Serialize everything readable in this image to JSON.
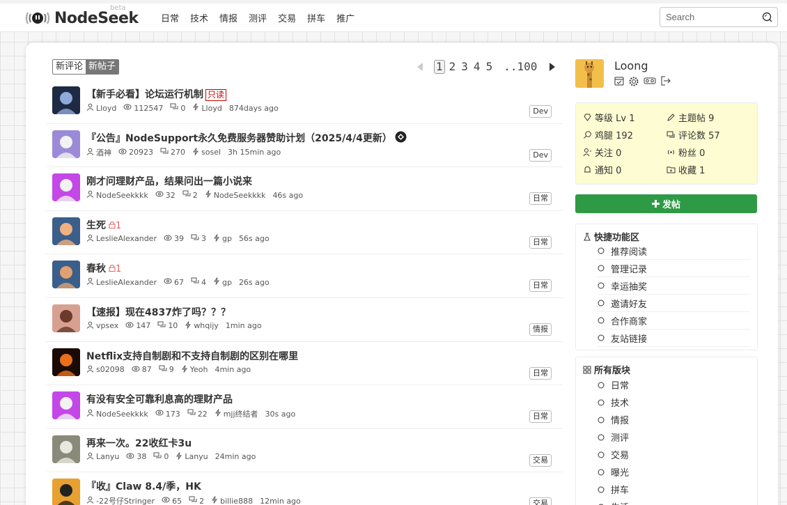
{
  "header": {
    "logo_text": "NodeSeek",
    "beta": "beta",
    "nav": [
      "日常",
      "技术",
      "情报",
      "测评",
      "交易",
      "拼车",
      "推广"
    ],
    "search_placeholder": "Search"
  },
  "toggle": {
    "left": "新评论",
    "right": "新帖子"
  },
  "pager": {
    "pages": [
      "1",
      "2",
      "3",
      "4",
      "5"
    ],
    "last": "..100",
    "current": "1"
  },
  "posts": [
    {
      "title": "【新手必看】论坛运行机制",
      "tag": "只读",
      "author": "Lloyd",
      "views": "112547",
      "comments": "0",
      "last_reply": "Lloyd",
      "time": "874days ago",
      "category": "Dev"
    },
    {
      "title": "『公告』NodeSupport永久免费服务器赞助计划（2025/4/4更新）",
      "author": "酒神",
      "views": "20923",
      "comments": "270",
      "last_reply": "sosel",
      "time": "3h 15min ago",
      "category": "Dev"
    },
    {
      "title": "刚才问理财产品，结果问出一篇小说来",
      "author": "NodeSeekkkk",
      "views": "32",
      "comments": "2",
      "last_reply": "NodeSeekkkk",
      "time": "46s ago",
      "category": "日常"
    },
    {
      "title": "生死",
      "lock": "1",
      "author": "LeslieAlexander",
      "views": "39",
      "comments": "3",
      "last_reply": "gp",
      "time": "56s ago",
      "category": "日常"
    },
    {
      "title": "春秋",
      "lock": "1",
      "author": "LeslieAlexander",
      "views": "67",
      "comments": "4",
      "last_reply": "gp",
      "time": "26s ago",
      "category": "日常"
    },
    {
      "title": "【速报】现在4837炸了吗？？？",
      "author": "vpsex",
      "views": "147",
      "comments": "10",
      "last_reply": "whqijy",
      "time": "1min ago",
      "category": "情报"
    },
    {
      "title": "Netflix支持自制剧和不支持自制剧的区别在哪里",
      "author": "s02098",
      "views": "87",
      "comments": "9",
      "last_reply": "Yeoh",
      "time": "4min ago",
      "category": "日常"
    },
    {
      "title": "有没有安全可靠利息高的理财产品",
      "author": "NodeSeekkkk",
      "views": "173",
      "comments": "22",
      "last_reply": "mjj终结者",
      "time": "30s ago",
      "category": "日常"
    },
    {
      "title": "再来一次。22收红卡3u",
      "author": "Lanyu",
      "views": "38",
      "comments": "0",
      "last_reply": "Lanyu",
      "time": "24min ago",
      "category": "交易"
    },
    {
      "title": "『收』Claw 8.4/季，HK",
      "author": "-22号仔Stringer",
      "views": "65",
      "comments": "2",
      "last_reply": "billie888",
      "time": "12min ago",
      "category": "交易"
    }
  ],
  "user": {
    "name": "Loong"
  },
  "stats": {
    "level": "等级 Lv 1",
    "topics": "主题帖 9",
    "chicken": "鸡腿 192",
    "replies": "评论数 57",
    "following": "关注 0",
    "fans": "粉丝 0",
    "notify": "通知 0",
    "favorites": "收藏 1"
  },
  "post_button": "发帖",
  "quick": {
    "title": "快捷功能区",
    "items": [
      "推荐阅读",
      "管理记录",
      "幸运抽奖",
      "邀请好友",
      "合作商家",
      "友站链接"
    ]
  },
  "boards": {
    "title": "所有版块",
    "items": [
      "日常",
      "技术",
      "情报",
      "测评",
      "交易",
      "曝光",
      "拼车",
      "生活"
    ]
  },
  "colors": {
    "accent_green": "#2e9a45",
    "stats_bg": "#fdfcd2",
    "lock_red": "#e06060"
  }
}
